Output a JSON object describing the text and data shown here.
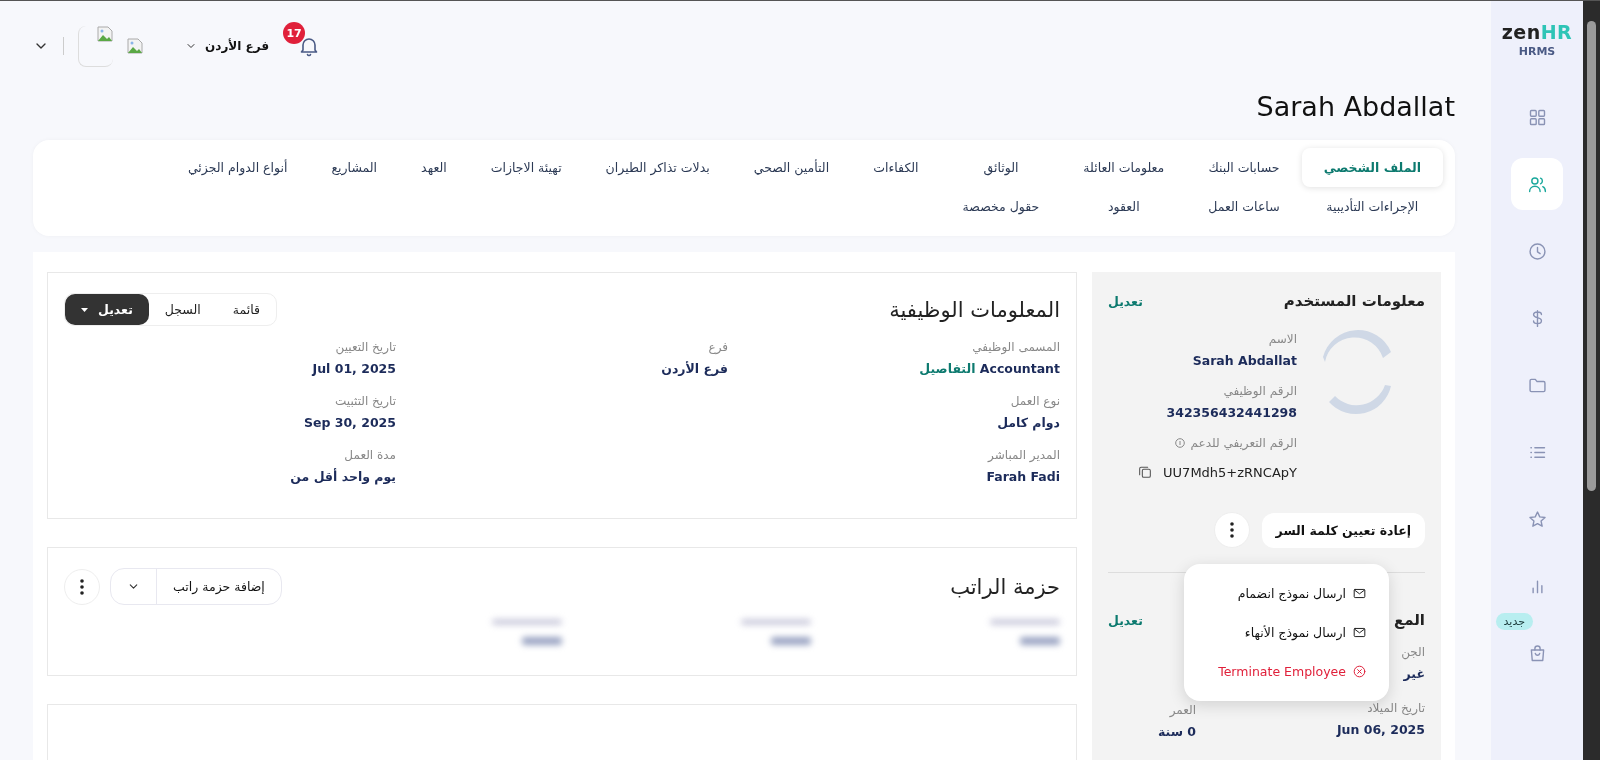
{
  "header": {
    "notifications": "17",
    "branch": "فرع الأردن"
  },
  "title": "Sarah Abdallat",
  "tabs": [
    {
      "label": "الملف الشخصي",
      "selected": true
    },
    {
      "label": "حسابات البنك",
      "selected": false
    },
    {
      "label": "معلومات العائلة",
      "selected": false
    },
    {
      "label": "الوثائق",
      "selected": false
    },
    {
      "label": "الكفاءات",
      "selected": false
    },
    {
      "label": "التأمين الصحي",
      "selected": false
    },
    {
      "label": "بدلات تذاكر الطيران",
      "selected": false
    },
    {
      "label": "تهيئة الاجازات",
      "selected": false
    },
    {
      "label": "العهد",
      "selected": false
    },
    {
      "label": "المشاريع",
      "selected": false
    },
    {
      "label": "أنواع الدوام الجزئي",
      "selected": false
    },
    {
      "label": "الإجراءات التأديبية",
      "selected": false
    },
    {
      "label": "ساعات العمل",
      "selected": false
    },
    {
      "label": "العقود",
      "selected": false
    },
    {
      "label": "حقول مخصصة",
      "selected": false
    }
  ],
  "job_info": {
    "title": "المعلومات الوظيفية",
    "actions": [
      {
        "label": "قائمة",
        "kind": "plain"
      },
      {
        "label": "السجل",
        "kind": "plain"
      },
      {
        "label": "تعديل",
        "kind": "primary"
      }
    ],
    "columns": [
      {
        "fields": [
          {
            "label": "المسمى الوظيفي",
            "value": "Accountant",
            "link": "التفاصيل"
          },
          {
            "label": "نوع العمل",
            "value": "دوام كامل"
          },
          {
            "label": "المدير المباشر",
            "value": "Farah Fadi"
          }
        ]
      },
      {
        "fields": [
          {
            "label": "فرع",
            "value": "فرع الأردن"
          }
        ]
      },
      {
        "fields": [
          {
            "label": "تاريخ التعيين",
            "value": "Jul 01, 2025"
          },
          {
            "label": "تاريخ التثبيت",
            "value": "Sep 30, 2025"
          },
          {
            "label": "مدة العمل",
            "value": "يوم واحد أقل من"
          }
        ]
      }
    ]
  },
  "salary": {
    "title": "حزمة الراتب",
    "add_button": "إضافة حزمة راتب"
  },
  "user_info": {
    "title": "معلومات المستخدم",
    "edit": "تعديل",
    "fields": [
      {
        "label": "الاسم",
        "value": "Sarah Abdallat"
      },
      {
        "label": "الرقم الوظيفي",
        "value": "342356432441298"
      }
    ],
    "support_id": {
      "label": "الرقم التعريفي للدعم",
      "value": "UU7Mdh5+zRNCApY"
    },
    "reset_button": "إعادة تعيين كلمة السر"
  },
  "personal_info": {
    "title": "المع",
    "edit": "تعديل",
    "fields": [
      {
        "label": "الجن",
        "value": "غير"
      },
      {
        "label": "تاريخ الميلاد",
        "value": "Jun 06, 2025"
      }
    ],
    "left_fields": [
      {
        "label": "العمر",
        "value": "0 سنة"
      }
    ]
  },
  "menu": [
    {
      "label": "ارسال نموذج انضمام",
      "kind": "send"
    },
    {
      "label": "ارسال نموذج الأنهاء",
      "kind": "send"
    },
    {
      "label": "Terminate Employee",
      "kind": "danger"
    }
  ],
  "sidebar": {
    "logo": {
      "text": "zen",
      "accent": "HR"
    },
    "subtitle": "HRMS",
    "items": [
      {
        "selected": false
      },
      {
        "selected": true
      },
      {
        "selected": false
      },
      {
        "selected": false
      },
      {
        "selected": false
      },
      {
        "selected": false
      },
      {
        "selected": false
      },
      {
        "selected": false
      },
      {
        "selected": false,
        "badge": "جديد"
      }
    ]
  }
}
